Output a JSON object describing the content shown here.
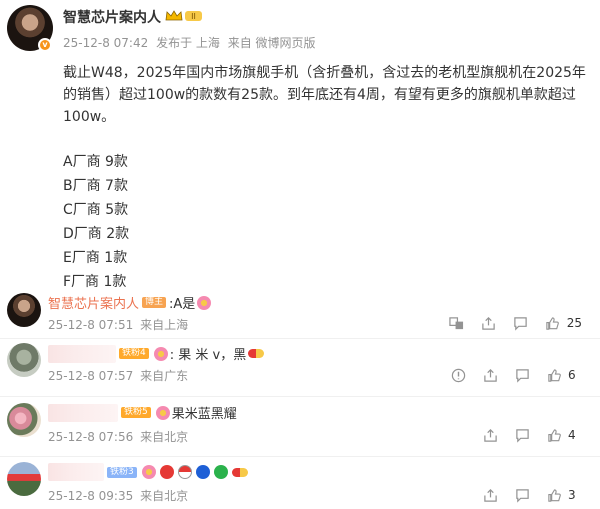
{
  "post": {
    "author": "智慧芯片案内人",
    "time": "25-12-8 07:42",
    "edited": "发布于 上海",
    "source": "来自 微博网页版",
    "text": "截止W48，2025年国内市场旗舰手机（含折叠机，含过去的老机型旗舰机在2025年的销售）超过100w的款数有25款。到年底还有4周，有望有更多的旗舰机单款超过100w。",
    "vendors": [
      "A厂商  9款",
      "B厂商  7款",
      "C厂商  5款",
      "D厂商  2款",
      "E厂商  1款",
      "F厂商  1款"
    ]
  },
  "comments": [
    {
      "name": "智慧芯片案内人",
      "tag": "博主",
      "text": ":A是",
      "time": "25-12-8 07:51",
      "location": "来自上海",
      "likes": "25"
    },
    {
      "tag": "铁粉4",
      "text": ": 果 米 v，黑",
      "time": "25-12-8 07:57",
      "location": "来自广东",
      "likes": "6"
    },
    {
      "tag": "铁粉5",
      "text": "果米蓝黑耀",
      "time": "25-12-8 07:56",
      "location": "来自北京",
      "likes": "4"
    },
    {
      "tag": "铁粉3",
      "time": "25-12-8 09:35",
      "location": "来自北京",
      "likes": "3"
    }
  ],
  "icons": {
    "reply": "comment-icon",
    "share": "share-icon",
    "like": "thumbs-up-icon",
    "report": "report-icon",
    "translate": "translate-icon"
  }
}
